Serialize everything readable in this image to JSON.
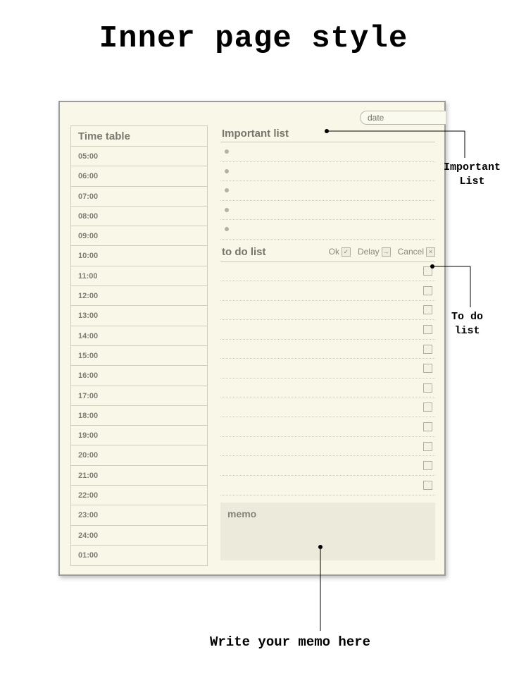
{
  "title": "Inner page style",
  "date_label": "date",
  "timetable": {
    "header": "Time table",
    "hours": [
      "05:00",
      "06:00",
      "07:00",
      "08:00",
      "09:00",
      "10:00",
      "11:00",
      "12:00",
      "13:00",
      "14:00",
      "15:00",
      "16:00",
      "17:00",
      "18:00",
      "19:00",
      "20:00",
      "21:00",
      "22:00",
      "23:00",
      "24:00",
      "01:00"
    ]
  },
  "important": {
    "header": "Important list",
    "rows": 5
  },
  "todo": {
    "header": "to do list",
    "legend_ok": "Ok",
    "legend_delay": "Delay",
    "legend_cancel": "Cancel",
    "rows": 12
  },
  "memo_label": "memo",
  "callouts": {
    "important": "Important\nList",
    "todo": "To do\nlist",
    "memo": "Write your memo here"
  }
}
